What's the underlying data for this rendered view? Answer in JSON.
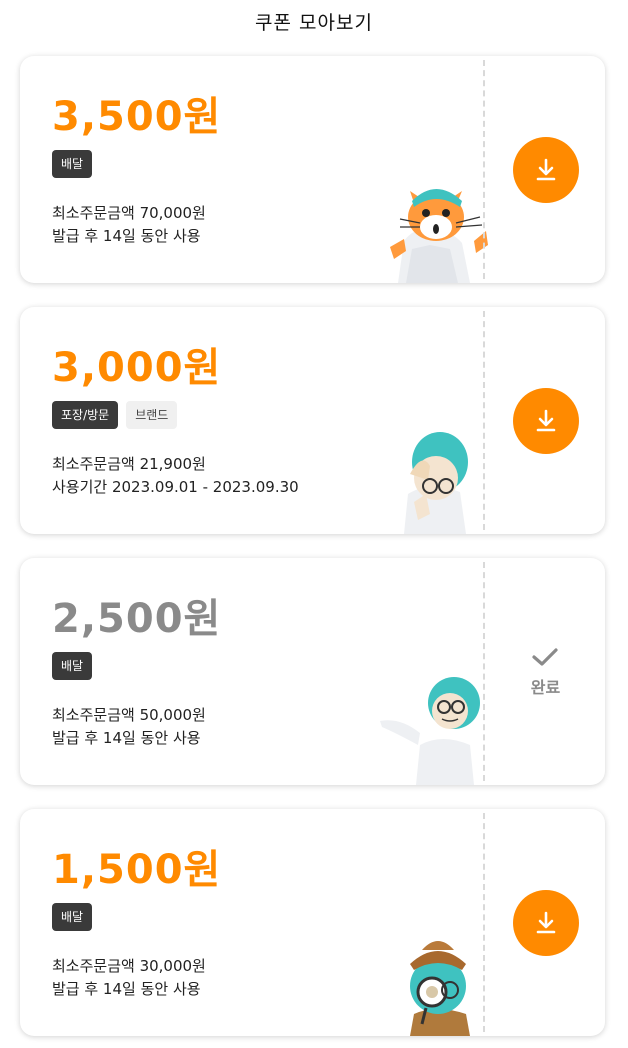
{
  "header": {
    "title": "쿠폰 모아보기"
  },
  "colors": {
    "accent": "#ff8a00",
    "muted": "#8a8a8a",
    "tag_dark": "#3a3a3a",
    "tag_light": "#f0f0f0"
  },
  "coupons": [
    {
      "amount": "3,500원",
      "tags": [
        {
          "label": "배달",
          "style": "dark"
        }
      ],
      "min_order": "최소주문금액 70,000원",
      "validity": "발급 후 14일 동안 사용",
      "status": "download",
      "mascot": "cat-mascot"
    },
    {
      "amount": "3,000원",
      "tags": [
        {
          "label": "포장/방문",
          "style": "dark"
        },
        {
          "label": "브랜드",
          "style": "light"
        }
      ],
      "min_order": "최소주문금액 21,900원",
      "validity": "사용기간 2023.09.01 - 2023.09.30",
      "status": "download",
      "mascot": "worried-mascot"
    },
    {
      "amount": "2,500원",
      "tags": [
        {
          "label": "배달",
          "style": "dark"
        }
      ],
      "min_order": "최소주문금액 50,000원",
      "validity": "발급 후 14일 동안 사용",
      "status": "done",
      "done_label": "완료",
      "mascot": "pointing-mascot"
    },
    {
      "amount": "1,500원",
      "tags": [
        {
          "label": "배달",
          "style": "dark"
        }
      ],
      "min_order": "최소주문금액 30,000원",
      "validity": "발급 후 14일 동안 사용",
      "status": "download",
      "mascot": "detective-mascot"
    }
  ],
  "icons": {
    "download": "download-icon",
    "check": "check-icon"
  }
}
